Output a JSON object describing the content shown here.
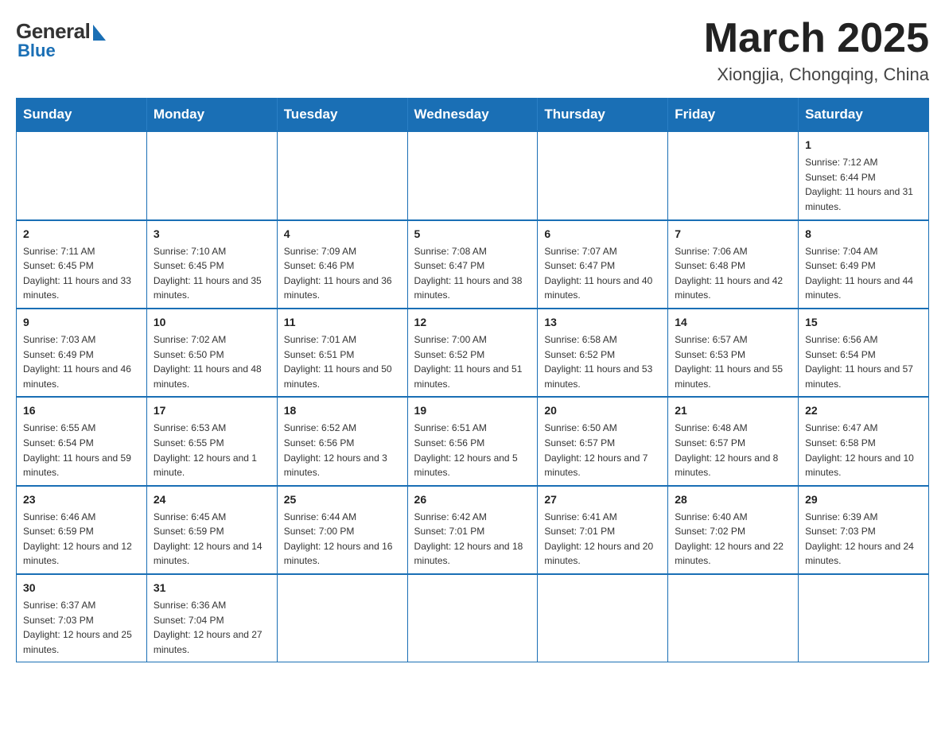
{
  "header": {
    "logo_general": "General",
    "logo_blue": "Blue",
    "month_year": "March 2025",
    "location": "Xiongjia, Chongqing, China"
  },
  "weekdays": [
    "Sunday",
    "Monday",
    "Tuesday",
    "Wednesday",
    "Thursday",
    "Friday",
    "Saturday"
  ],
  "weeks": [
    [
      {
        "day": "",
        "sunrise": "",
        "sunset": "",
        "daylight": ""
      },
      {
        "day": "",
        "sunrise": "",
        "sunset": "",
        "daylight": ""
      },
      {
        "day": "",
        "sunrise": "",
        "sunset": "",
        "daylight": ""
      },
      {
        "day": "",
        "sunrise": "",
        "sunset": "",
        "daylight": ""
      },
      {
        "day": "",
        "sunrise": "",
        "sunset": "",
        "daylight": ""
      },
      {
        "day": "",
        "sunrise": "",
        "sunset": "",
        "daylight": ""
      },
      {
        "day": "1",
        "sunrise": "Sunrise: 7:12 AM",
        "sunset": "Sunset: 6:44 PM",
        "daylight": "Daylight: 11 hours and 31 minutes."
      }
    ],
    [
      {
        "day": "2",
        "sunrise": "Sunrise: 7:11 AM",
        "sunset": "Sunset: 6:45 PM",
        "daylight": "Daylight: 11 hours and 33 minutes."
      },
      {
        "day": "3",
        "sunrise": "Sunrise: 7:10 AM",
        "sunset": "Sunset: 6:45 PM",
        "daylight": "Daylight: 11 hours and 35 minutes."
      },
      {
        "day": "4",
        "sunrise": "Sunrise: 7:09 AM",
        "sunset": "Sunset: 6:46 PM",
        "daylight": "Daylight: 11 hours and 36 minutes."
      },
      {
        "day": "5",
        "sunrise": "Sunrise: 7:08 AM",
        "sunset": "Sunset: 6:47 PM",
        "daylight": "Daylight: 11 hours and 38 minutes."
      },
      {
        "day": "6",
        "sunrise": "Sunrise: 7:07 AM",
        "sunset": "Sunset: 6:47 PM",
        "daylight": "Daylight: 11 hours and 40 minutes."
      },
      {
        "day": "7",
        "sunrise": "Sunrise: 7:06 AM",
        "sunset": "Sunset: 6:48 PM",
        "daylight": "Daylight: 11 hours and 42 minutes."
      },
      {
        "day": "8",
        "sunrise": "Sunrise: 7:04 AM",
        "sunset": "Sunset: 6:49 PM",
        "daylight": "Daylight: 11 hours and 44 minutes."
      }
    ],
    [
      {
        "day": "9",
        "sunrise": "Sunrise: 7:03 AM",
        "sunset": "Sunset: 6:49 PM",
        "daylight": "Daylight: 11 hours and 46 minutes."
      },
      {
        "day": "10",
        "sunrise": "Sunrise: 7:02 AM",
        "sunset": "Sunset: 6:50 PM",
        "daylight": "Daylight: 11 hours and 48 minutes."
      },
      {
        "day": "11",
        "sunrise": "Sunrise: 7:01 AM",
        "sunset": "Sunset: 6:51 PM",
        "daylight": "Daylight: 11 hours and 50 minutes."
      },
      {
        "day": "12",
        "sunrise": "Sunrise: 7:00 AM",
        "sunset": "Sunset: 6:52 PM",
        "daylight": "Daylight: 11 hours and 51 minutes."
      },
      {
        "day": "13",
        "sunrise": "Sunrise: 6:58 AM",
        "sunset": "Sunset: 6:52 PM",
        "daylight": "Daylight: 11 hours and 53 minutes."
      },
      {
        "day": "14",
        "sunrise": "Sunrise: 6:57 AM",
        "sunset": "Sunset: 6:53 PM",
        "daylight": "Daylight: 11 hours and 55 minutes."
      },
      {
        "day": "15",
        "sunrise": "Sunrise: 6:56 AM",
        "sunset": "Sunset: 6:54 PM",
        "daylight": "Daylight: 11 hours and 57 minutes."
      }
    ],
    [
      {
        "day": "16",
        "sunrise": "Sunrise: 6:55 AM",
        "sunset": "Sunset: 6:54 PM",
        "daylight": "Daylight: 11 hours and 59 minutes."
      },
      {
        "day": "17",
        "sunrise": "Sunrise: 6:53 AM",
        "sunset": "Sunset: 6:55 PM",
        "daylight": "Daylight: 12 hours and 1 minute."
      },
      {
        "day": "18",
        "sunrise": "Sunrise: 6:52 AM",
        "sunset": "Sunset: 6:56 PM",
        "daylight": "Daylight: 12 hours and 3 minutes."
      },
      {
        "day": "19",
        "sunrise": "Sunrise: 6:51 AM",
        "sunset": "Sunset: 6:56 PM",
        "daylight": "Daylight: 12 hours and 5 minutes."
      },
      {
        "day": "20",
        "sunrise": "Sunrise: 6:50 AM",
        "sunset": "Sunset: 6:57 PM",
        "daylight": "Daylight: 12 hours and 7 minutes."
      },
      {
        "day": "21",
        "sunrise": "Sunrise: 6:48 AM",
        "sunset": "Sunset: 6:57 PM",
        "daylight": "Daylight: 12 hours and 8 minutes."
      },
      {
        "day": "22",
        "sunrise": "Sunrise: 6:47 AM",
        "sunset": "Sunset: 6:58 PM",
        "daylight": "Daylight: 12 hours and 10 minutes."
      }
    ],
    [
      {
        "day": "23",
        "sunrise": "Sunrise: 6:46 AM",
        "sunset": "Sunset: 6:59 PM",
        "daylight": "Daylight: 12 hours and 12 minutes."
      },
      {
        "day": "24",
        "sunrise": "Sunrise: 6:45 AM",
        "sunset": "Sunset: 6:59 PM",
        "daylight": "Daylight: 12 hours and 14 minutes."
      },
      {
        "day": "25",
        "sunrise": "Sunrise: 6:44 AM",
        "sunset": "Sunset: 7:00 PM",
        "daylight": "Daylight: 12 hours and 16 minutes."
      },
      {
        "day": "26",
        "sunrise": "Sunrise: 6:42 AM",
        "sunset": "Sunset: 7:01 PM",
        "daylight": "Daylight: 12 hours and 18 minutes."
      },
      {
        "day": "27",
        "sunrise": "Sunrise: 6:41 AM",
        "sunset": "Sunset: 7:01 PM",
        "daylight": "Daylight: 12 hours and 20 minutes."
      },
      {
        "day": "28",
        "sunrise": "Sunrise: 6:40 AM",
        "sunset": "Sunset: 7:02 PM",
        "daylight": "Daylight: 12 hours and 22 minutes."
      },
      {
        "day": "29",
        "sunrise": "Sunrise: 6:39 AM",
        "sunset": "Sunset: 7:03 PM",
        "daylight": "Daylight: 12 hours and 24 minutes."
      }
    ],
    [
      {
        "day": "30",
        "sunrise": "Sunrise: 6:37 AM",
        "sunset": "Sunset: 7:03 PM",
        "daylight": "Daylight: 12 hours and 25 minutes."
      },
      {
        "day": "31",
        "sunrise": "Sunrise: 6:36 AM",
        "sunset": "Sunset: 7:04 PM",
        "daylight": "Daylight: 12 hours and 27 minutes."
      },
      {
        "day": "",
        "sunrise": "",
        "sunset": "",
        "daylight": ""
      },
      {
        "day": "",
        "sunrise": "",
        "sunset": "",
        "daylight": ""
      },
      {
        "day": "",
        "sunrise": "",
        "sunset": "",
        "daylight": ""
      },
      {
        "day": "",
        "sunrise": "",
        "sunset": "",
        "daylight": ""
      },
      {
        "day": "",
        "sunrise": "",
        "sunset": "",
        "daylight": ""
      }
    ]
  ]
}
